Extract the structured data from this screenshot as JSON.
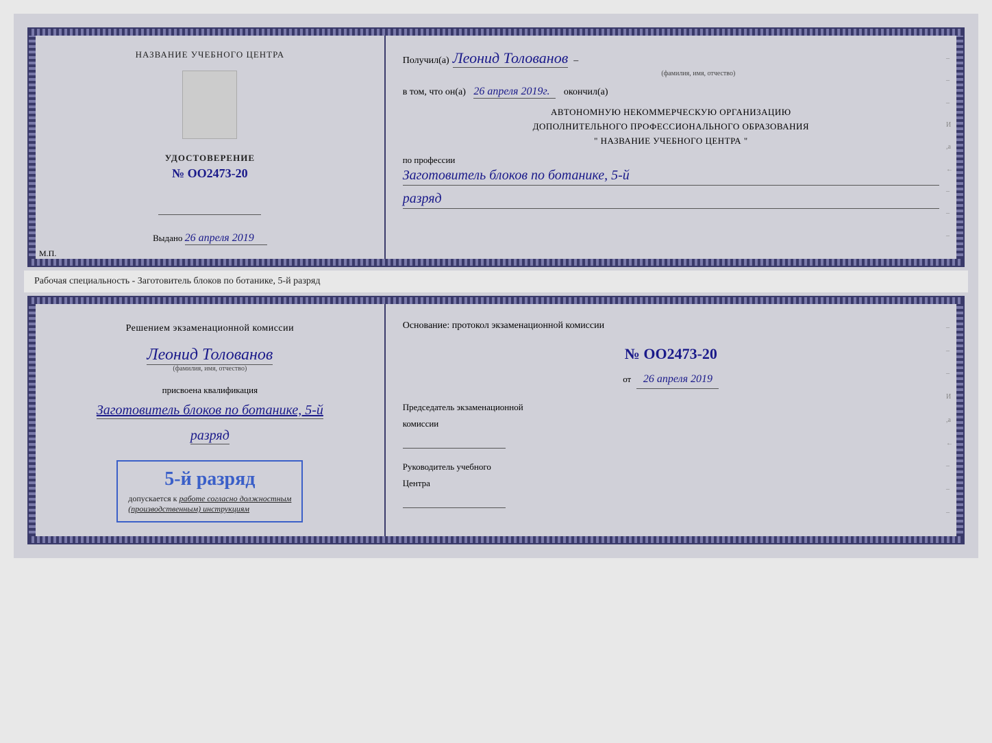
{
  "topDoc": {
    "left": {
      "centerTitle": "НАЗВАНИЕ УЧЕБНОГО ЦЕНТРА",
      "udostoverenie": "УДОСТОВЕРЕНИЕ",
      "number": "№ OO2473-20",
      "vydanoLabel": "Выдано",
      "vydanoDate": "26 апреля 2019",
      "mpLabel": "М.П."
    },
    "right": {
      "poluchilLabel": "Получил(а)",
      "recipientName": "Леонид Толованов",
      "fioSubtitle": "(фамилия, имя, отчество)",
      "dashAfterName": "–",
      "vtomChtoLabel": "в том, что он(а)",
      "completionDate": "26 апреля 2019г.",
      "okonchilLabel": "окончил(а)",
      "avtonomnuyu1": "АВТОНОМНУЮ НЕКОММЕРЧЕСКУЮ ОРГАНИЗАЦИЮ",
      "avtonomnuyu2": "ДОПОЛНИТЕЛЬНОГО ПРОФЕССИОНАЛЬНОГО ОБРАЗОВАНИЯ",
      "nazvanie": "\"  НАЗВАНИЕ УЧЕБНОГО ЦЕНТРА  \"",
      "poProfessiiLabel": "по профессии",
      "profession": "Заготовитель блоков по ботанике, 5-й",
      "razryad": "разряд"
    }
  },
  "separator": {
    "text": "Рабочая специальность - Заготовитель блоков по ботанике, 5-й разряд"
  },
  "bottomDoc": {
    "left": {
      "resheniyemLabel": "Решением экзаменационной комиссии",
      "recipientName": "Леонид Толованов",
      "fioSubtitle": "(фамилия, имя, отчество)",
      "prisvoenaLabel": "присвоена квалификация",
      "qualification": "Заготовитель блоков по ботанике, 5-й",
      "razryad": "разряд",
      "stampRazryad": "5-й разряд",
      "dopuskaetsyaLabel": "допускается к",
      "dopuskaetsyaText": "работе согласно должностным",
      "dopuskaetsyaText2": "(производственным) инструкциям"
    },
    "right": {
      "osnovaniePrefixLabel": "Основание: протокол экзаменационной комиссии",
      "protocolNumber": "№ OO2473-20",
      "otLabel": "от",
      "otDate": "26 апреля 2019",
      "predsedatelLabel": "Председатель экзаменационной",
      "komissiiLabel": "комиссии",
      "rukovoditelLabel": "Руководитель учебного",
      "tsentraLabel": "Центра"
    }
  },
  "sideMarks": {
    "marks": [
      "–",
      "–",
      "–",
      "И",
      ",а",
      "←",
      "–",
      "–",
      "–",
      "–"
    ]
  }
}
